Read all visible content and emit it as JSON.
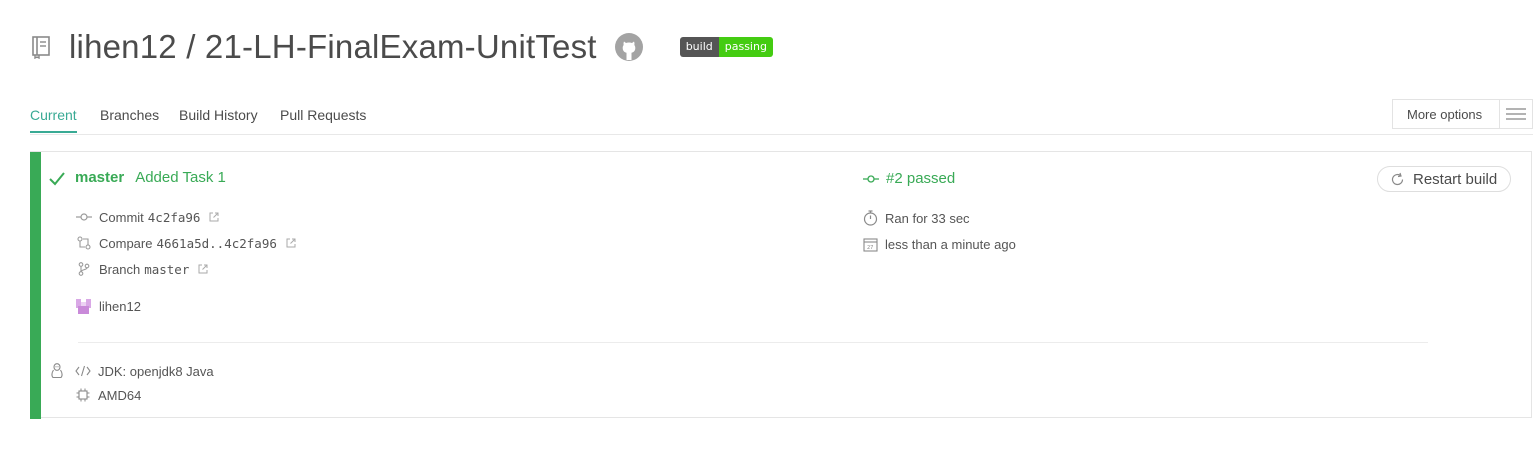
{
  "header": {
    "repo_title": "lihen12 / 21-LH-FinalExam-UnitTest",
    "badge": {
      "left": "build",
      "right": "passing"
    }
  },
  "tabs": [
    {
      "label": "Current"
    },
    {
      "label": "Branches"
    },
    {
      "label": "Build History"
    },
    {
      "label": "Pull Requests"
    }
  ],
  "more_options": {
    "label": "More options"
  },
  "build": {
    "branch": "master",
    "commit_message": "Added Task 1",
    "commit_label": "Commit",
    "commit_sha": "4c2fa96",
    "compare_label": "Compare",
    "compare_range": "4661a5d..4c2fa96",
    "branch_label": "Branch",
    "branch_value": "master",
    "author": "lihen12",
    "status": "#2 passed",
    "duration": "Ran for 33 sec",
    "finished": "less than a minute ago",
    "restart_label": "Restart build",
    "jdk": "JDK: openjdk8 Java",
    "arch": "AMD64"
  },
  "colors": {
    "accent": "#39aa94",
    "passed": "#39aa56",
    "badge_dark": "#555555",
    "badge_green": "#44cc11"
  },
  "icons": [
    "repo-icon",
    "github-icon",
    "menu-icon",
    "check-icon",
    "commit-icon",
    "compare-icon",
    "branch-icon",
    "external-link-icon",
    "avatar",
    "stopwatch-icon",
    "calendar-icon",
    "restart-icon",
    "linux-icon",
    "code-icon",
    "cpu-icon"
  ]
}
